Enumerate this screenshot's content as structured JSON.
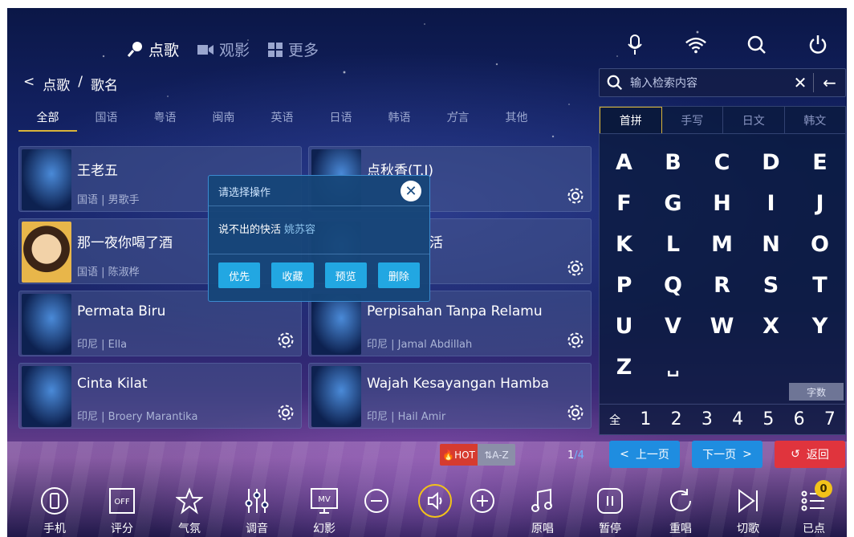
{
  "top_nav": {
    "tabs": [
      "点歌",
      "观影",
      "更多"
    ]
  },
  "breadcrumb": {
    "root": "点歌",
    "separator": "/",
    "current": "歌名"
  },
  "categories": [
    "全部",
    "国语",
    "粤语",
    "闽南",
    "英语",
    "日语",
    "韩语",
    "方言",
    "其他"
  ],
  "songs": [
    {
      "title": "王老五",
      "meta": "国语 | 男歌手"
    },
    {
      "title": "点秋香(T.I)",
      "meta": ""
    },
    {
      "title": "那一夜你喝了酒",
      "meta": "国语 | 陈淑桦"
    },
    {
      "title": "活",
      "meta": ""
    },
    {
      "title": "Permata Biru",
      "meta": "印尼 | Ella"
    },
    {
      "title": "Perpisahan Tanpa Relamu",
      "meta": "印尼 | Jamal Abdillah"
    },
    {
      "title": "Cinta Kilat",
      "meta": "印尼 | Broery Marantika"
    },
    {
      "title": "Wajah Kesayangan Hamba",
      "meta": "印尼 | Hail Amir"
    }
  ],
  "popup": {
    "title": "请选择操作",
    "song": "说不出的快活",
    "artist": "姚苏容",
    "buttons": [
      "优先",
      "收藏",
      "预览",
      "删除"
    ]
  },
  "search": {
    "placeholder": "输入检索内容"
  },
  "keyboard": {
    "tabs": [
      "首拼",
      "手写",
      "日文",
      "韩文"
    ],
    "letters": [
      "A",
      "B",
      "C",
      "D",
      "E",
      "F",
      "G",
      "H",
      "I",
      "J",
      "K",
      "L",
      "M",
      "N",
      "O",
      "P",
      "Q",
      "R",
      "S",
      "T",
      "U",
      "V",
      "W",
      "X",
      "Y",
      "Z",
      "␣"
    ],
    "count_label": "字数",
    "digits": [
      "全",
      "1",
      "2",
      "3",
      "4",
      "5",
      "6",
      "7"
    ]
  },
  "sort": {
    "hot": "HOT",
    "az": "A-Z"
  },
  "pager": {
    "current": "1",
    "total": "/4",
    "prev": "上一页",
    "next": "下一页",
    "back": "返回"
  },
  "bottom_bar": {
    "items": [
      "手机",
      "评分",
      "气氛",
      "调音",
      "幻影",
      "原唱",
      "暂停",
      "重唱",
      "切歌",
      "已点"
    ],
    "queued_count": "0",
    "score_toggle": "OFF",
    "mv_label": "MV"
  },
  "colors": {
    "accent_blue": "#1f8de0",
    "return_red": "#e0343d",
    "hot_red": "#d63b2f",
    "tab_gold": "#d9b43a"
  }
}
